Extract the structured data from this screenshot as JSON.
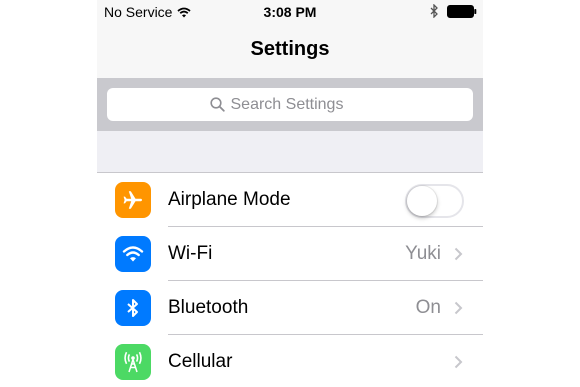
{
  "status_bar": {
    "carrier": "No Service",
    "time": "3:08 PM",
    "icons": [
      "wifi-icon",
      "bluetooth-icon",
      "battery-icon"
    ]
  },
  "navbar": {
    "title": "Settings"
  },
  "search": {
    "placeholder": "Search Settings",
    "value": ""
  },
  "settings": [
    {
      "label": "Airplane Mode",
      "icon": "airplane-icon",
      "icon_color": "#ff9500",
      "control": "toggle",
      "toggle_on": false
    },
    {
      "label": "Wi-Fi",
      "icon": "wifi-icon",
      "icon_color": "#007aff",
      "detail": "Yuki",
      "control": "chevron"
    },
    {
      "label": "Bluetooth",
      "icon": "bluetooth-icon",
      "icon_color": "#007aff",
      "detail": "On",
      "control": "chevron"
    },
    {
      "label": "Cellular",
      "icon": "cellular-icon",
      "icon_color": "#4cd964",
      "detail": "",
      "control": "chevron"
    }
  ]
}
